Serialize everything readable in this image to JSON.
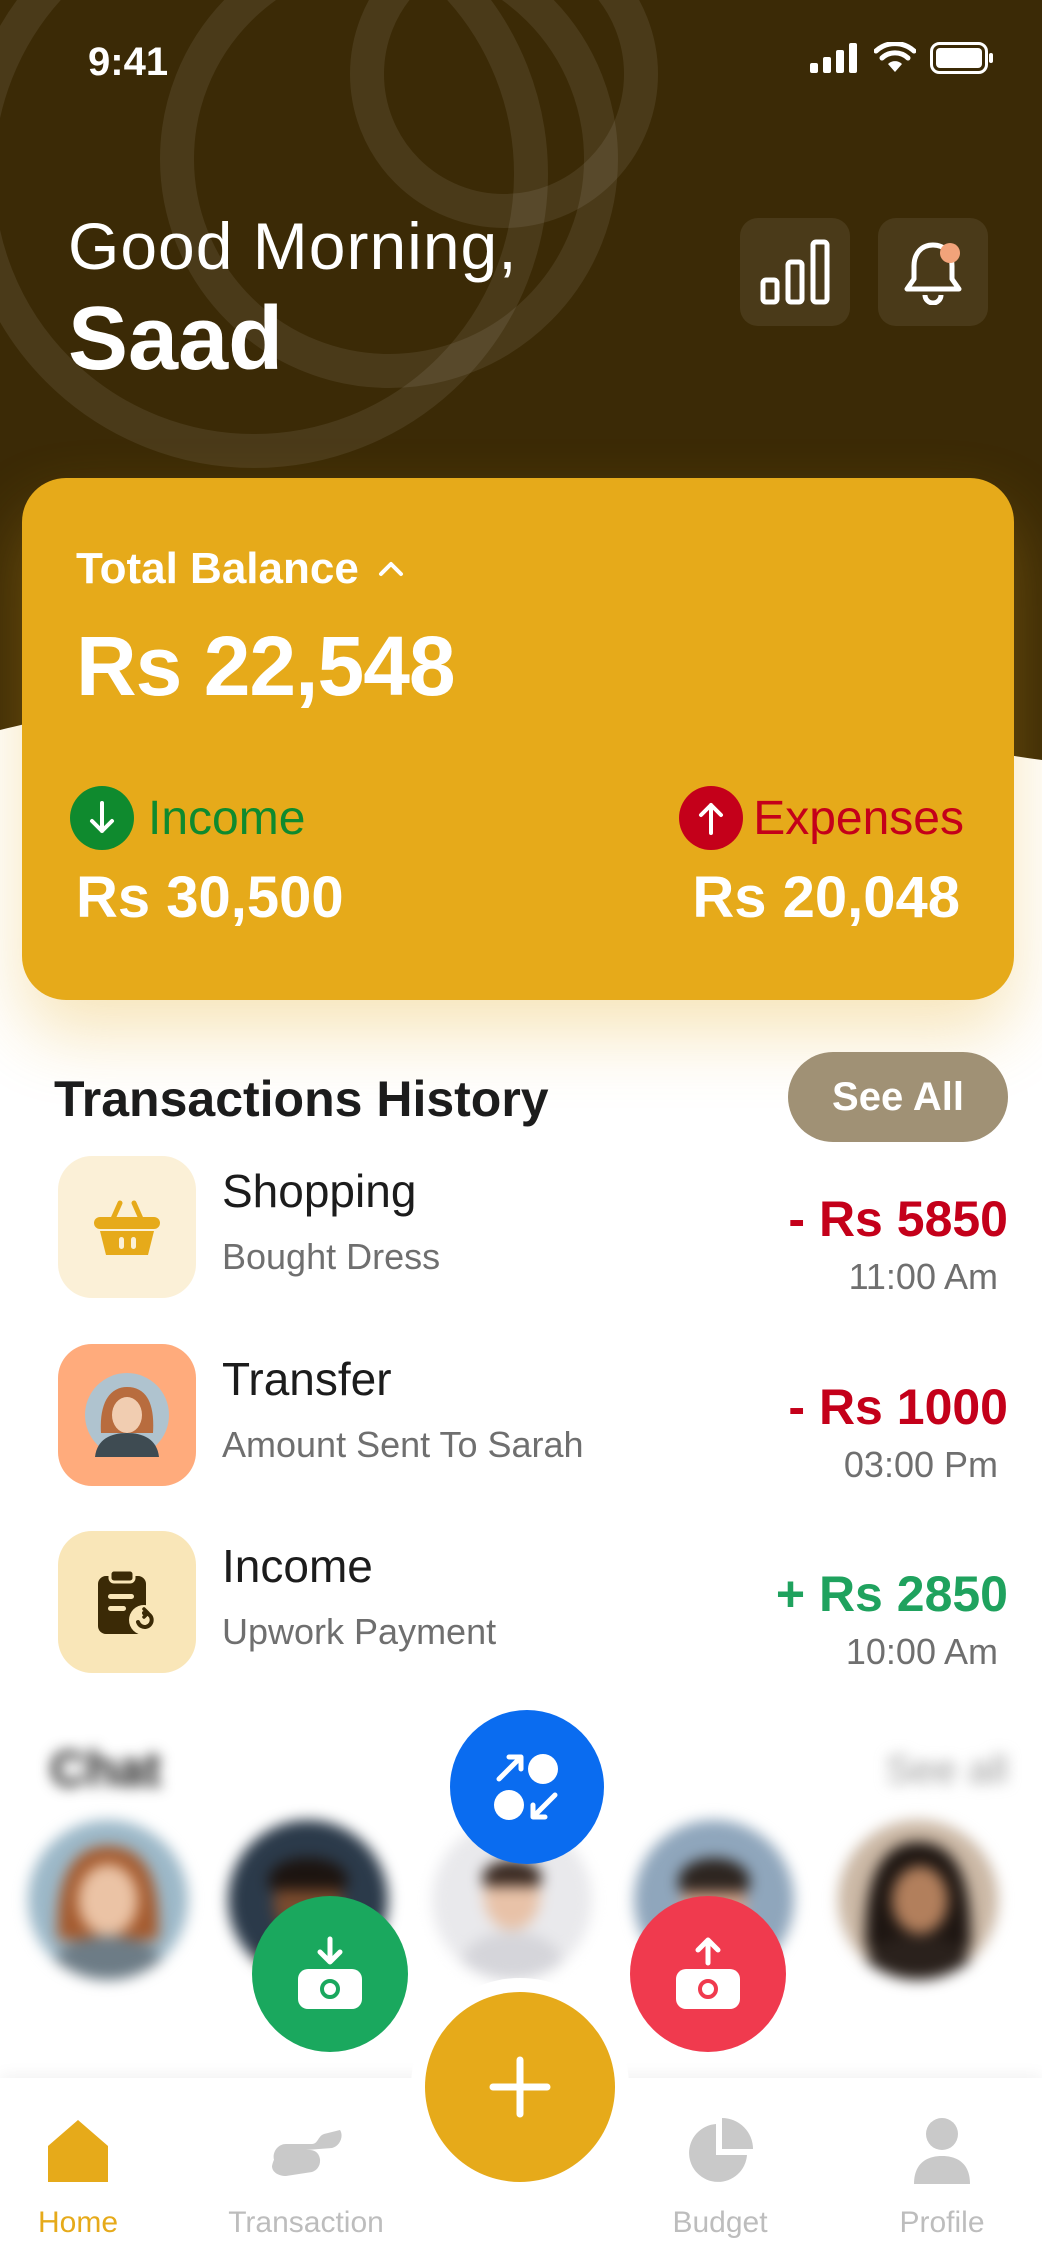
{
  "status_bar": {
    "time": "9:41"
  },
  "header": {
    "greeting": "Good Morning,",
    "user_name": "Saad"
  },
  "balance_card": {
    "label": "Total Balance",
    "value": "Rs 22,548",
    "income_label": "Income",
    "income_value": "Rs 30,500",
    "expenses_label": "Expenses",
    "expenses_value": "Rs 20,048"
  },
  "transactions": {
    "title": "Transactions History",
    "see_all_label": "See All",
    "items": [
      {
        "name": "Shopping",
        "sub": "Bought Dress",
        "amount": "- Rs 5850",
        "time": "11:00 Am",
        "type": "debit",
        "icon": "shopping-basket-icon"
      },
      {
        "name": "Transfer",
        "sub": "Amount Sent To Sarah",
        "amount": "- Rs 1000",
        "time": "03:00 Pm",
        "type": "debit",
        "icon": "avatar"
      },
      {
        "name": "Income",
        "sub": "Upwork Payment",
        "amount": "+ Rs 2850",
        "time": "10:00 Am",
        "type": "credit",
        "icon": "clipboard-icon"
      }
    ]
  },
  "chat": {
    "title": "Chat",
    "see_all_label": "See all"
  },
  "nav": {
    "items": [
      {
        "label": "Home",
        "icon": "home-icon",
        "active": true
      },
      {
        "label": "Transaction",
        "icon": "transaction-icon",
        "active": false
      },
      {
        "label": "Budget",
        "icon": "pie-chart-icon",
        "active": false
      },
      {
        "label": "Profile",
        "icon": "user-icon",
        "active": false
      }
    ]
  },
  "colors": {
    "header_bg": "#3B2A06",
    "card_bg": "#E6AA1A",
    "income_green": "#0F8A2E",
    "expense_red": "#C4001A",
    "credit_green": "#1FA25E",
    "fab_blue": "#0A6CF0",
    "fab_green": "#1AA85E",
    "fab_red": "#F03A4E"
  }
}
